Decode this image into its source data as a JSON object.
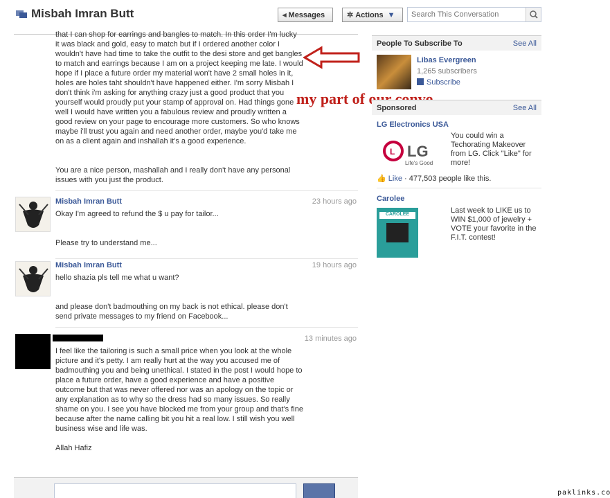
{
  "header": {
    "title": "Misbah Imran Butt",
    "messages_button": "Messages",
    "actions_button": "Actions",
    "search_placeholder": "Search This Conversation"
  },
  "messages": [
    {
      "cut_text": "that I can shop for earrings and bangles to match. In this order I'm lucky",
      "paragraphs": [
        "it was black and gold, easy to match but if I ordered another color I wouldn't have had time to take the outfit to the desi store and get bangles to match and earrings because I am on a project keeping me late. I would hope if I place a future order my material won't have 2 small holes in it, holes are holes taht shouldn't have happened either. I'm sorry Misbah I don't think i'm asking for anything crazy just a good product that you yourself would proudly put your stamp of approval on. Had things gone well I would have written you a fabulous review and proudly written a good review on your page to encourage more customers. So who knows maybe i'll trust you again and need another order, maybe you'd take me on as a client again and inshallah it's a good experience.",
        "You are a nice person, mashallah and I really don't have any personal issues with you just the product."
      ]
    },
    {
      "author": "Misbah Imran Butt",
      "time": "23 hours ago",
      "paragraphs": [
        "Okay I'm agreed to refund the $ u pay for tailor...",
        "Please try to understand me..."
      ]
    },
    {
      "author": "Misbah Imran Butt",
      "time": "19 hours ago",
      "paragraphs": [
        "hello shazia pls tell me what u want?",
        "and please don't badmouthing on my back is not ethical. please don't send private messages to my friend on Facebook..."
      ]
    },
    {
      "time": "13 minutes ago",
      "paragraphs": [
        "I feel like the tailoring is such a small price when you look at the whole picture and it's petty. I am really hurt at the way you accused me of badmouthing you and being unethical. I stated in the post I would hope to place a future order, have a good experience and have a positive outcome but that was never offered nor was an apology on the topic or any explanation as to why so the dress had so many issues. So really shame on you. I see you have blocked me from your group and that's fine because after the name calling bit you hit a real low. I still wish you well business wise and life was.",
        "Allah Hafiz"
      ]
    }
  ],
  "sidebar": {
    "subscribe_header": "People To Subscribe To",
    "see_all": "See All",
    "page_name": "Libas Evergreen",
    "subscriber_count": "1,265 subscribers",
    "subscribe_label": "Subscribe",
    "sponsored_header": "Sponsored",
    "ads": [
      {
        "title": "LG Electronics USA",
        "logo_text": "LG",
        "logo_tagline": "Life's Good",
        "text": "You could win a Techorating Makeover from LG. Click \"Like\" for more!",
        "like_label": "Like",
        "like_count": "477,503 people like this."
      },
      {
        "title": "Carolee",
        "image_text": "CAROLEE",
        "text": "Last week to LIKE us to WIN $1,000 of jewelry + VOTE your favorite in the F.I.T. contest!"
      }
    ]
  },
  "annotation": "my part of our convo",
  "watermark": "paklinks.com",
  "colors": {
    "link": "#3b5998",
    "annotation": "#c0211b"
  }
}
